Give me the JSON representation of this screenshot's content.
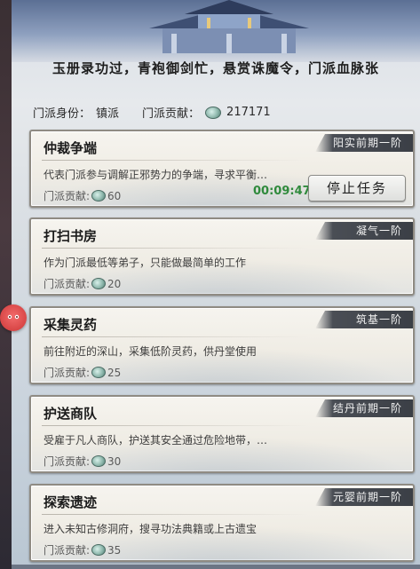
{
  "headline": "玉册录功过，青袍御剑忙，悬赏诛魔令，门派血脉张",
  "info": {
    "identity_label": "门派身份：",
    "identity_value": "镇派",
    "contribution_label": "门派贡献：",
    "contribution_value": "217171",
    "contribution_icon": "jade-coin-icon"
  },
  "missions": [
    {
      "title": "仲裁争端",
      "rank": "阳实前期一阶",
      "description": "代表门派参与调解正邪势力的争端，寻求平衡…",
      "reward_label": "门派贡献:",
      "reward_value": "60",
      "timer": "00:09:47",
      "button_label": "停止任务"
    },
    {
      "title": "打扫书房",
      "rank": "凝气一阶",
      "description": "作为门派最低等弟子，只能做最简单的工作",
      "reward_label": "门派贡献:",
      "reward_value": "20"
    },
    {
      "title": "采集灵药",
      "rank": "筑基一阶",
      "description": "前往附近的深山，采集低阶灵药，供丹堂使用",
      "reward_label": "门派贡献:",
      "reward_value": "25"
    },
    {
      "title": "护送商队",
      "rank": "结丹前期一阶",
      "description": "受雇于凡人商队，护送其安全通过危险地带，…",
      "reward_label": "门派贡献:",
      "reward_value": "30"
    },
    {
      "title": "探索遗迹",
      "rank": "元婴前期一阶",
      "description": "进入未知古修洞府，搜寻功法典籍或上古遗宝",
      "reward_label": "门派贡献:",
      "reward_value": "35"
    }
  ],
  "colors": {
    "timer": "#2f8a3c",
    "rank_banner": "#3b3f46",
    "side_button": "#d84646"
  }
}
